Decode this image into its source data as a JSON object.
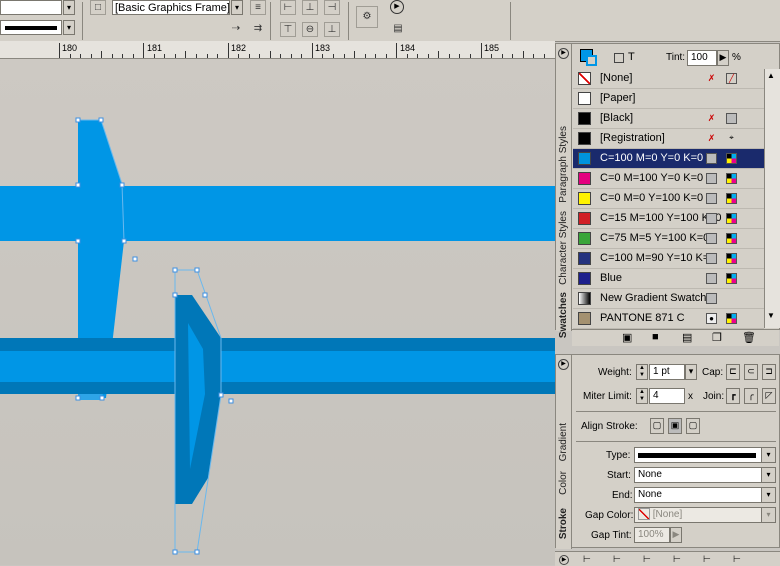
{
  "toolbar": {
    "object_style_value": "[Basic Graphics Frame]+",
    "stroke_style_value": ""
  },
  "ruler": {
    "labels": [
      "180",
      "181",
      "182",
      "183",
      "184",
      "185"
    ]
  },
  "swatches": {
    "tint_label": "Tint:",
    "tint_value": "100",
    "tint_unit": "%",
    "tab_labels": [
      "Paragraph Styles",
      "Character Styles",
      "Swatches"
    ],
    "items": [
      {
        "name": "[None]",
        "color": "#ffffff",
        "none": true
      },
      {
        "name": "[Paper]",
        "color": "#ffffff"
      },
      {
        "name": "[Black]",
        "color": "#000000"
      },
      {
        "name": "[Registration]",
        "color": "#000000"
      },
      {
        "name": "C=100 M=0 Y=0 K=0",
        "color": "#0093dd",
        "selected": true
      },
      {
        "name": "C=0 M=100 Y=0 K=0",
        "color": "#e4007f"
      },
      {
        "name": "C=0 M=0 Y=100 K=0",
        "color": "#fff200"
      },
      {
        "name": "C=15 M=100 Y=100 K=0",
        "color": "#d11f26"
      },
      {
        "name": "C=75 M=5 Y=100 K=0",
        "color": "#3aa53a"
      },
      {
        "name": "C=100 M=90 Y=10 K=0",
        "color": "#24327e"
      },
      {
        "name": "Blue",
        "color": "#1d1f8c"
      },
      {
        "name": "New Gradient Swatch",
        "color": "#888888",
        "gradient": true
      },
      {
        "name": "PANTONE 871 C",
        "color": "#a49170"
      }
    ]
  },
  "stroke": {
    "tab_labels": [
      "Gradient",
      "Color",
      "Stroke"
    ],
    "weight_label": "Weight:",
    "weight_value": "1 pt",
    "cap_label": "Cap:",
    "miter_label": "Miter Limit:",
    "miter_value": "4",
    "miter_unit": "x",
    "join_label": "Join:",
    "align_label": "Align Stroke:",
    "type_label": "Type:",
    "start_label": "Start:",
    "start_value": "None",
    "end_label": "End:",
    "end_value": "None",
    "gap_color_label": "Gap Color:",
    "gap_color_value": "[None]",
    "gap_tint_label": "Gap Tint:",
    "gap_tint_value": "100%"
  },
  "colors": {
    "cyan": "#0096e6",
    "cyan_dark": "#0077b8",
    "selection": "#3da0e8",
    "selected_row": "#1a2a6c"
  }
}
